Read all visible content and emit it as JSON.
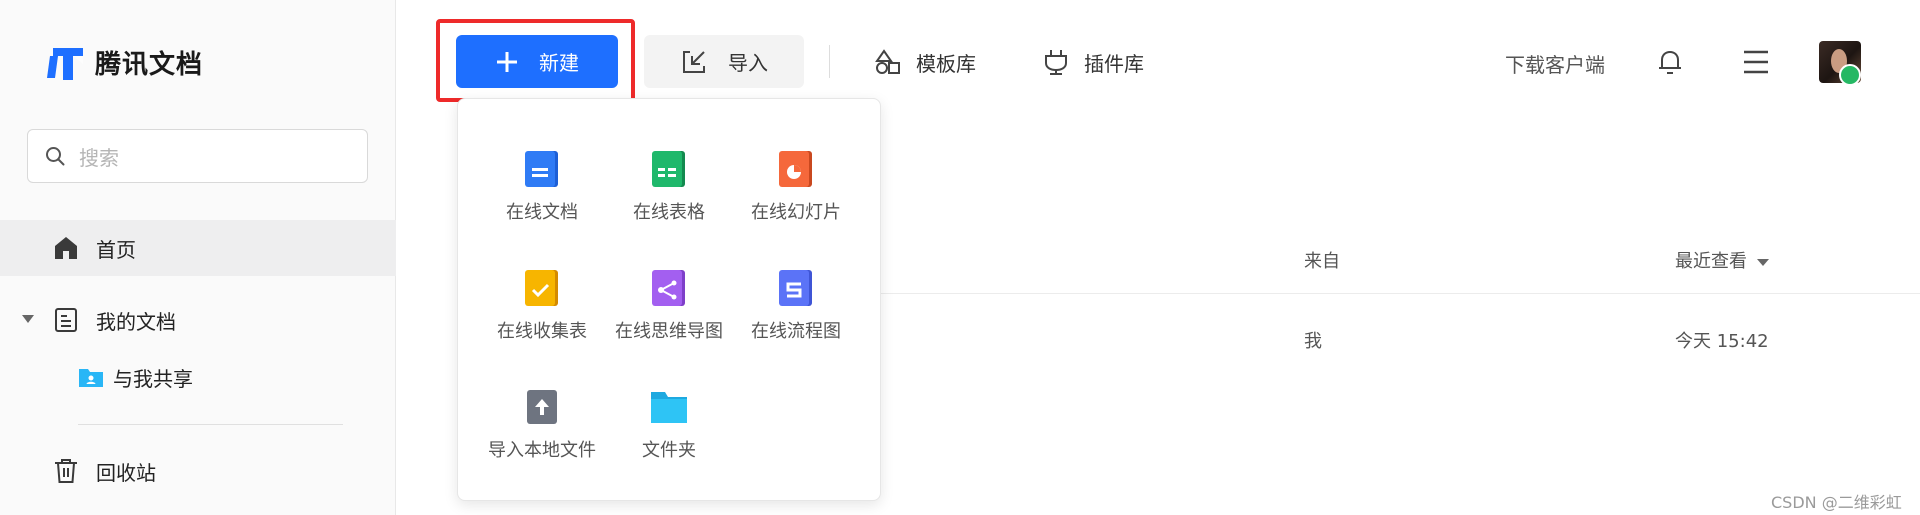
{
  "app": {
    "name": "腾讯文档"
  },
  "sidebar": {
    "search_placeholder": "搜索",
    "items": [
      {
        "label": "首页",
        "icon": "home-icon",
        "active": true
      },
      {
        "label": "我的文档",
        "icon": "document-icon",
        "expanded": true
      },
      {
        "label": "与我共享",
        "icon": "shared-folder-icon"
      },
      {
        "label": "回收站",
        "icon": "trash-icon"
      }
    ]
  },
  "toolbar": {
    "new_label": "新建",
    "import_label": "导入",
    "templates_label": "模板库",
    "plugins_label": "插件库",
    "download_label": "下载客户端"
  },
  "table": {
    "columns": {
      "from": "来自",
      "last_viewed": "最近查看"
    },
    "rows": [
      {
        "from": "我",
        "last_viewed": "今天 15:42"
      }
    ]
  },
  "new_menu": {
    "items": [
      {
        "label": "在线文档",
        "icon": "online-doc-icon"
      },
      {
        "label": "在线表格",
        "icon": "online-sheet-icon"
      },
      {
        "label": "在线幻灯片",
        "icon": "online-slides-icon"
      },
      {
        "label": "在线收集表",
        "icon": "online-form-icon"
      },
      {
        "label": "在线思维导图",
        "icon": "online-mindmap-icon"
      },
      {
        "label": "在线流程图",
        "icon": "online-flowchart-icon"
      },
      {
        "label": "导入本地文件",
        "icon": "import-local-file-icon"
      },
      {
        "label": "文件夹",
        "icon": "folder-icon"
      }
    ]
  },
  "colors": {
    "primary": "#1e6fff",
    "highlight_border": "#ee2a2a",
    "doc": "#2f7bf5",
    "sheet": "#1fb86b",
    "slides": "#f5683b",
    "form": "#f7b500",
    "mindmap": "#a35ff0",
    "flowchart": "#5b73f7",
    "folder": "#2ec4f5"
  },
  "watermark": "CSDN @二维彩虹"
}
